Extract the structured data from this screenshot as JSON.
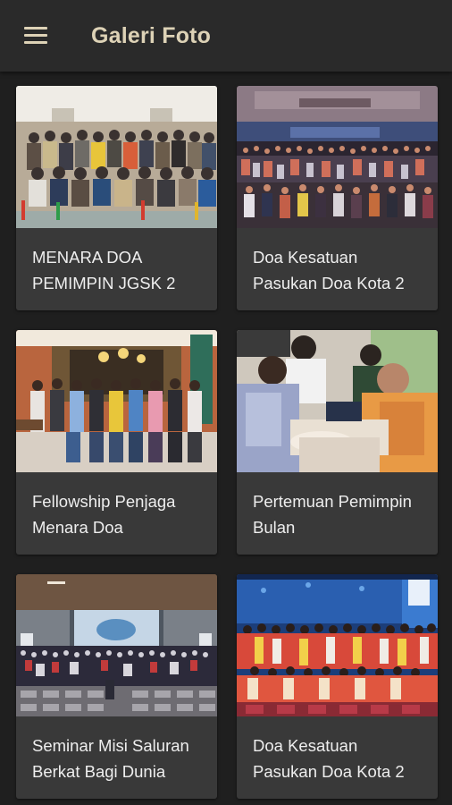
{
  "app_bar": {
    "title": "Galeri Foto",
    "menu_icon": "hamburger-menu-icon",
    "text_color": "#ddd2b6",
    "background": "#2a2a2a"
  },
  "gallery": {
    "items": [
      {
        "caption": "MENARA DOA PEMIMPIN JGSK 2"
      },
      {
        "caption": "Doa Kesatuan Pasukan Doa Kota 2"
      },
      {
        "caption": "Fellowship Penjaga Menara Doa"
      },
      {
        "caption": "Pertemuan Pemimpin Bulan"
      },
      {
        "caption": "Seminar Misi Saluran Berkat Bagi Dunia"
      },
      {
        "caption": "Doa Kesatuan Pasukan Doa Kota 2"
      }
    ]
  },
  "colors": {
    "page_background": "#1f1f1f",
    "card_background": "#393939",
    "caption_text": "#eeeeee"
  }
}
